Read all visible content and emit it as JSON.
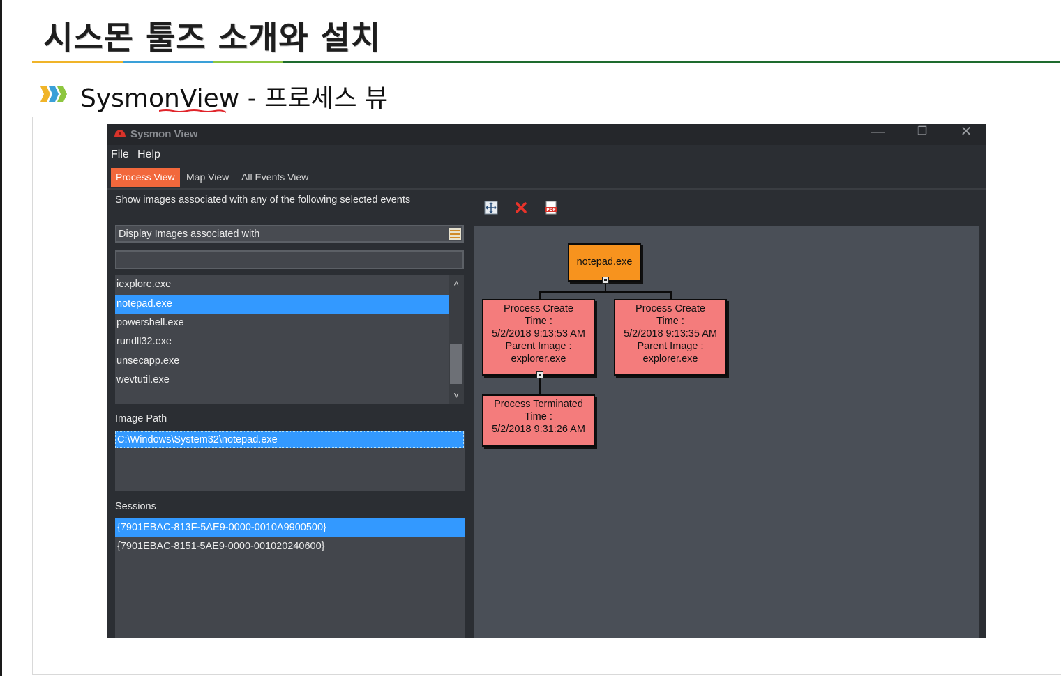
{
  "slide": {
    "title": "시스몬 툴즈 소개와 설치",
    "subtitle": "SysmonView - 프로세스 뷰"
  },
  "window": {
    "title": "Sysmon View",
    "controls": {
      "minimize": "—",
      "restore": "❐",
      "close": "✕"
    }
  },
  "menu": {
    "file": "File",
    "help": "Help"
  },
  "tabs": [
    {
      "label": "Process View",
      "active": true
    },
    {
      "label": "Map View",
      "active": false
    },
    {
      "label": "All Events View",
      "active": false
    }
  ],
  "left": {
    "instruction": "Show images associated with any of the following selected events",
    "combo_value": "Display Images associated with",
    "search_value": "",
    "images": [
      {
        "name": "iexplore.exe",
        "selected": false
      },
      {
        "name": "notepad.exe",
        "selected": true
      },
      {
        "name": "powershell.exe",
        "selected": false
      },
      {
        "name": "rundll32.exe",
        "selected": false
      },
      {
        "name": "unsecapp.exe",
        "selected": false
      },
      {
        "name": "wevtutil.exe",
        "selected": false
      }
    ],
    "image_path_label": "Image Path",
    "image_path": "C:\\Windows\\System32\\notepad.exe",
    "sessions_label": "Sessions",
    "sessions": [
      {
        "id": "{7901EBAC-813F-5AE9-0000-0010A9900500}",
        "selected": true
      },
      {
        "id": "{7901EBAC-8151-5AE9-0000-001020240600}",
        "selected": false
      }
    ]
  },
  "toolbar": {
    "icons": [
      "fit-view-icon",
      "clear-icon",
      "pdf-export-icon"
    ]
  },
  "graph": {
    "root": "notepad.exe",
    "create1": [
      "Process Create",
      "Time :",
      "5/2/2018 9:13:53 AM",
      "Parent Image :",
      "explorer.exe"
    ],
    "create2": [
      "Process Create",
      "Time :",
      "5/2/2018 9:13:35 AM",
      "Parent Image :",
      "explorer.exe"
    ],
    "terminated": [
      "Process Terminated",
      "Time :",
      "5/2/2018 9:31:26 AM"
    ]
  },
  "colors": {
    "active_tab": "#f2683c",
    "selection": "#3399ff",
    "root_node": "#f7931e",
    "event_node": "#f47c7c"
  }
}
